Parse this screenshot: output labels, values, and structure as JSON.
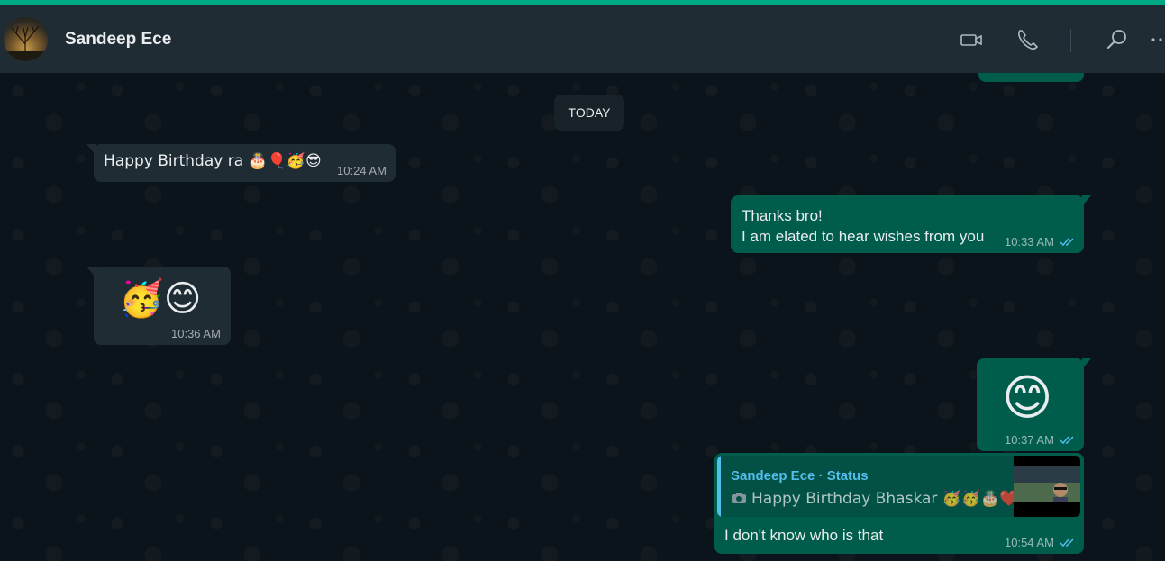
{
  "header": {
    "contact_name": "Sandeep Ece",
    "icons": [
      "video-call-icon",
      "voice-call-icon",
      "search-icon",
      "menu-icon"
    ]
  },
  "colors": {
    "accent": "#00a884",
    "incoming_bubble": "#202c33",
    "outgoing_bubble": "#005c4b",
    "quote_name": "#53bdeb",
    "read_ticks": "#53bdeb"
  },
  "day_separator": "TODAY",
  "messages": [
    {
      "direction": "in",
      "text": "Happy Birthday ra 🎂🎈🥳😎",
      "time": "10:24 AM"
    },
    {
      "direction": "out",
      "lines": [
        "Thanks bro!",
        "I am elated to hear wishes from you"
      ],
      "time": "10:33 AM",
      "status": "read"
    },
    {
      "direction": "in",
      "text": "🥳😊",
      "time": "10:36 AM"
    },
    {
      "direction": "out",
      "text": "😊",
      "time": "10:37 AM",
      "status": "read"
    },
    {
      "direction": "out",
      "quote": {
        "name": "Sandeep Ece · Status",
        "text": "Happy Birthday Bhaskar 🥳🥳🎂❤️"
      },
      "text": "I don't know who is that",
      "time": "10:54 AM",
      "status": "read"
    }
  ]
}
